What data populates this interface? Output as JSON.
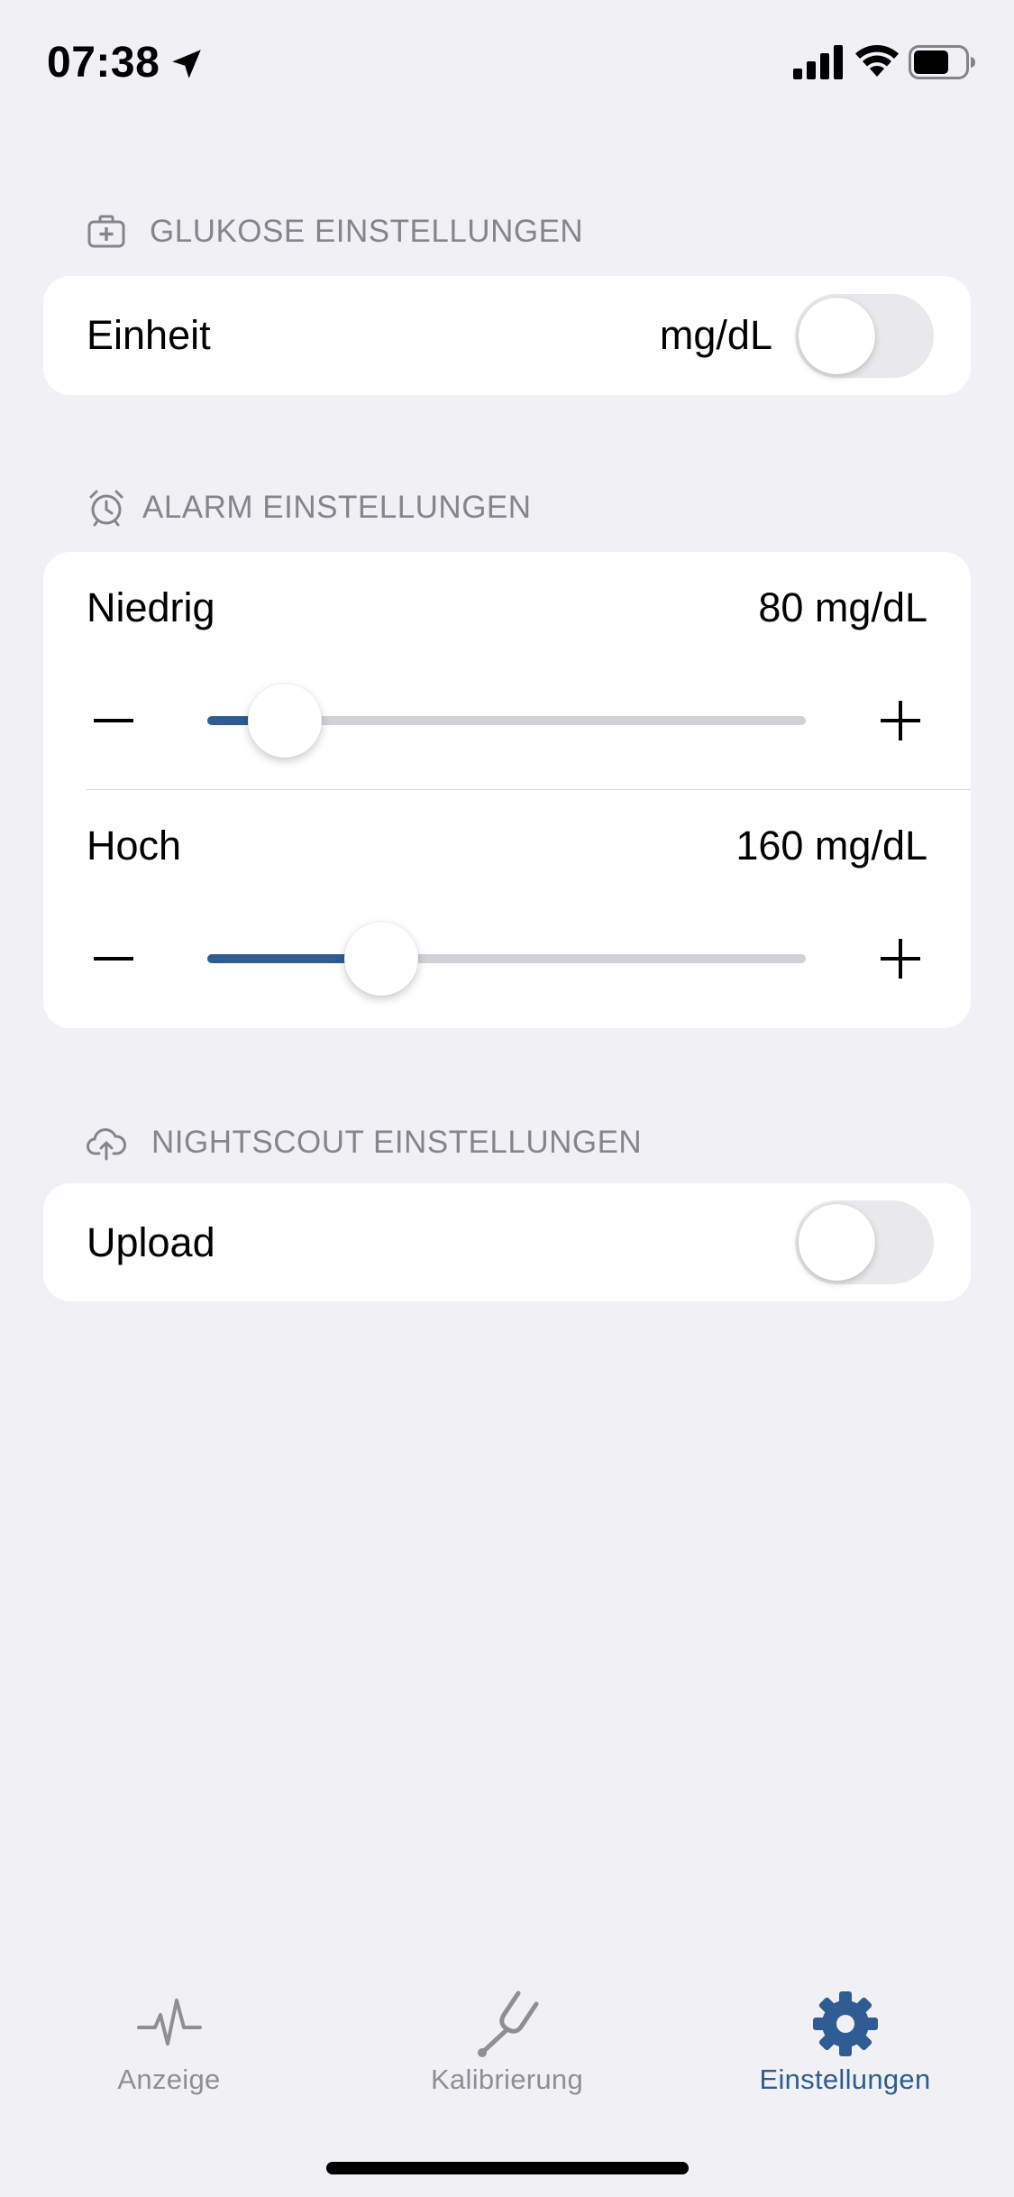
{
  "status_bar": {
    "time": "07:38"
  },
  "glucose_section": {
    "header": "GLUKOSE EINSTELLUNGEN",
    "unit_label": "Einheit",
    "unit_value": "mg/dL",
    "unit_toggle_on": false
  },
  "alarm_section": {
    "header": "ALARM EINSTELLUNGEN",
    "low": {
      "label": "Niedrig",
      "value_text": "80 mg/dL",
      "slider_fraction": 0.13
    },
    "high": {
      "label": "Hoch",
      "value_text": "160 mg/dL",
      "slider_fraction": 0.29
    }
  },
  "nightscout_section": {
    "header": "NIGHTSCOUT EINSTELLUNGEN",
    "upload_label": "Upload",
    "upload_toggle_on": false
  },
  "tab_bar": {
    "tabs": [
      {
        "label": "Anzeige",
        "icon": "waveform-icon",
        "active": false
      },
      {
        "label": "Kalibrierung",
        "icon": "tuning-fork-icon",
        "active": false
      },
      {
        "label": "Einstellungen",
        "icon": "gear-icon",
        "active": true
      }
    ]
  },
  "colors": {
    "accent": "#2e5c93",
    "inactive": "#8e8e93",
    "background": "#f0f0f5"
  }
}
